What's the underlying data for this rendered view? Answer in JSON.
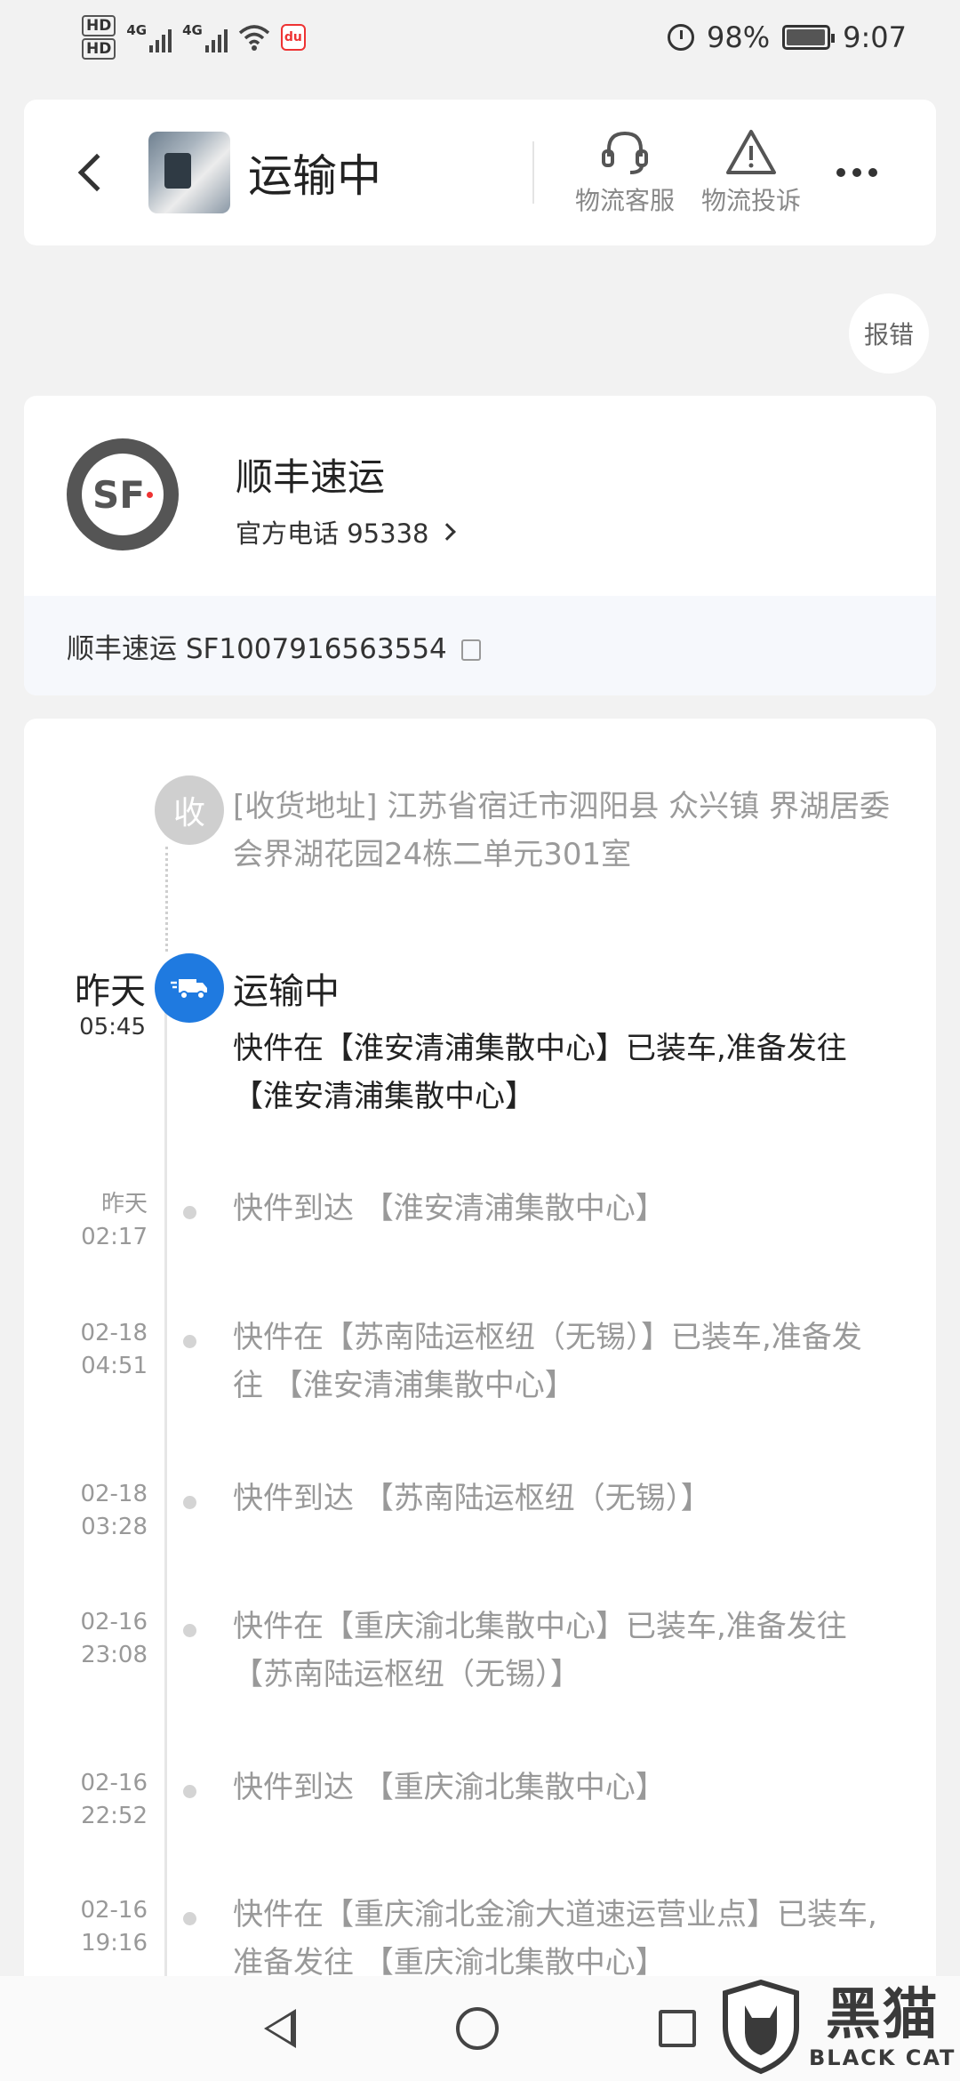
{
  "status_bar": {
    "hd1": "HD",
    "hd2": "HD",
    "net1": "4G",
    "net2": "4G",
    "app_badge": "du",
    "battery": "98%",
    "battery_level": 0.98,
    "time": "9:07"
  },
  "header": {
    "title": "运输中",
    "actions": [
      {
        "label": "物流客服",
        "icon": "headset-icon"
      },
      {
        "label": "物流投诉",
        "icon": "warning-icon"
      }
    ],
    "more_icon": "more-dots-icon"
  },
  "report_button": "报错",
  "courier": {
    "logo_text": "SF",
    "name": "顺丰速运",
    "phone_label": "官方电话 95338",
    "tracking": "顺丰速运 SF1007916563554"
  },
  "timeline": {
    "receiver": {
      "node_label": "收",
      "address": "[收货地址] 江苏省宿迁市泗阳县 众兴镇 界湖居委会界湖花园24栋二单元301室"
    },
    "current": {
      "day": "昨天",
      "time": "05:45",
      "status": "运输中",
      "desc": "快件在【淮安清浦集散中心】已装车,准备发往【淮安清浦集散中心】"
    },
    "events": [
      {
        "d1": "昨天",
        "d2": "02:17",
        "text": "快件到达 【淮安清浦集散中心】"
      },
      {
        "d1": "02-18",
        "d2": "04:51",
        "text": "快件在【苏南陆运枢纽（无锡）】已装车,准备发往 【淮安清浦集散中心】"
      },
      {
        "d1": "02-18",
        "d2": "03:28",
        "text": "快件到达 【苏南陆运枢纽（无锡）】"
      },
      {
        "d1": "02-16",
        "d2": "23:08",
        "text": "快件在【重庆渝北集散中心】已装车,准备发往 【苏南陆运枢纽（无锡）】"
      },
      {
        "d1": "02-16",
        "d2": "22:52",
        "text": "快件到达 【重庆渝北集散中心】"
      },
      {
        "d1": "02-16",
        "d2": "19:16",
        "text": "快件在【重庆渝北金渝大道速运营业点】已装车,准备发往 【重庆渝北集散中心】"
      }
    ]
  },
  "watermark": {
    "cn": "黑猫",
    "en": "BLACK CAT"
  },
  "colors": {
    "accent": "#1f7ae0",
    "background": "#f2f2f2"
  }
}
